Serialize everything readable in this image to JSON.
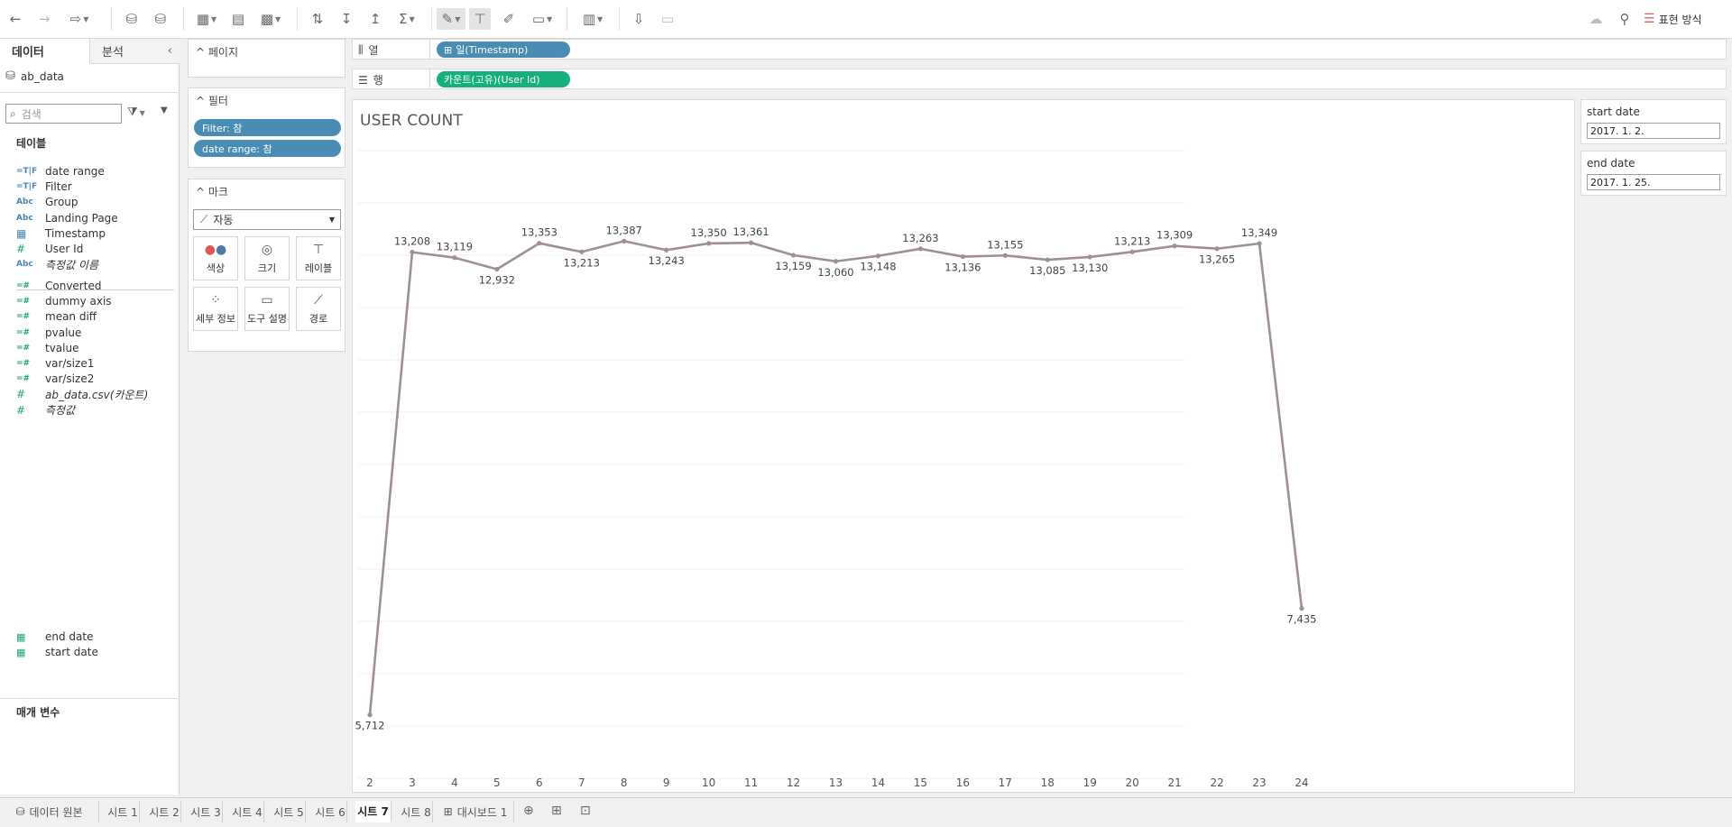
{
  "toolbar": {
    "undo": "←",
    "redo": "→",
    "replay": "⮌",
    "new_ds": "⛁",
    "pause": "⛁",
    "show_me_label": "표현 방식"
  },
  "datapane": {
    "tab_data": "데이터",
    "tab_analysis": "분석",
    "datasource": "ab_data",
    "search_placeholder": "검색",
    "tables_title": "테이블",
    "dimensions": [
      {
        "icon": "=T|F",
        "label": "date range"
      },
      {
        "icon": "=T|F",
        "label": "Filter"
      },
      {
        "icon": "Abc",
        "label": "Group"
      },
      {
        "icon": "Abc",
        "label": "Landing Page"
      },
      {
        "icon": "cal",
        "label": "Timestamp"
      },
      {
        "icon": "#",
        "label": "User Id"
      },
      {
        "icon": "Abc",
        "label": "측정값 이름"
      }
    ],
    "measures": [
      {
        "icon": "=#",
        "label": "Converted"
      },
      {
        "icon": "=#",
        "label": "dummy axis"
      },
      {
        "icon": "=#",
        "label": "mean diff"
      },
      {
        "icon": "=#",
        "label": "pvalue"
      },
      {
        "icon": "=#",
        "label": "tvalue"
      },
      {
        "icon": "=#",
        "label": "var/size1"
      },
      {
        "icon": "=#",
        "label": "var/size2"
      },
      {
        "icon": "#",
        "label": "ab_data.csv(카운트)"
      },
      {
        "icon": "#",
        "label": "측정값"
      }
    ],
    "params_title": "매개 변수",
    "params": [
      {
        "label": "end date"
      },
      {
        "label": "start date"
      }
    ]
  },
  "shelves": {
    "pages_title": "페이지",
    "filters_title": "필터",
    "filter_pills": [
      "Filter: 참",
      "date range: 참"
    ],
    "marks_title": "마크",
    "marks_type": "자동",
    "mark_buttons": [
      "색상",
      "크기",
      "레이블",
      "세부 정보",
      "도구 설명",
      "경로"
    ],
    "columns_label": "열",
    "rows_label": "행",
    "columns_pill": "일(Timestamp)",
    "rows_pill": "카운트(고유)(User Id)"
  },
  "viz": {
    "title": "USER COUNT"
  },
  "chart_data": {
    "type": "line",
    "title": "USER COUNT",
    "x": [
      2,
      3,
      4,
      5,
      6,
      7,
      8,
      9,
      10,
      11,
      12,
      13,
      14,
      15,
      16,
      17,
      18,
      19,
      20,
      21,
      22,
      23,
      24
    ],
    "values": [
      5712,
      13208,
      13119,
      12932,
      13353,
      13213,
      13387,
      13243,
      13350,
      13361,
      13159,
      13060,
      13148,
      13263,
      13136,
      13155,
      13085,
      13130,
      13213,
      13309,
      13265,
      13349,
      7435
    ],
    "labels": [
      "5,712",
      "13,208",
      "13,119",
      "12,932",
      "13,353",
      "13,213",
      "13,387",
      "13,243",
      "13,350",
      "13,361",
      "13,159",
      "13,060",
      "13,148",
      "13,263",
      "13,136",
      "13,155",
      "13,085",
      "13,130",
      "13,213",
      "13,309",
      "13,265",
      "13,349",
      "7,435"
    ],
    "label_pos": [
      "below",
      "above",
      "above",
      "below",
      "above",
      "below",
      "above",
      "below",
      "above",
      "above",
      "below",
      "below",
      "below",
      "above",
      "below",
      "above",
      "below",
      "below",
      "above",
      "above",
      "below",
      "above",
      "below"
    ],
    "ylim": [
      4800,
      15000
    ],
    "grid": true,
    "line_color": "#9e9090"
  },
  "params": {
    "start_title": "start date",
    "start_value": "2017. 1. 2.",
    "end_title": "end date",
    "end_value": "2017. 1. 25."
  },
  "tabs": {
    "datasource": "데이터 원본",
    "sheets": [
      "시트 1",
      "시트 2",
      "시트 3",
      "시트 4",
      "시트 5",
      "시트 6",
      "시트 7",
      "시트 8"
    ],
    "active": "시트 7",
    "dashboard": "대시보드 1"
  }
}
